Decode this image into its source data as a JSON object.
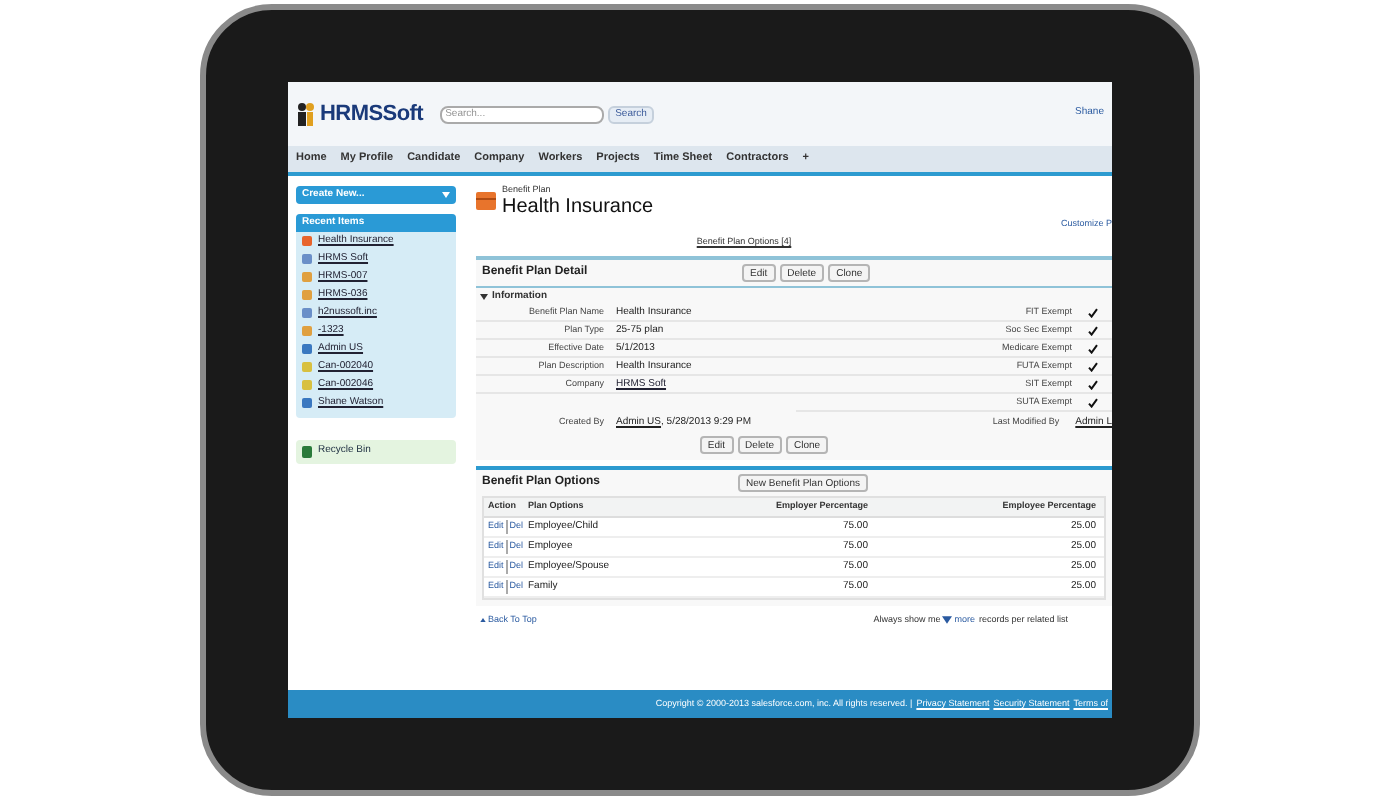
{
  "header": {
    "logo": "HRMSSoft",
    "search": {
      "placeholder": "Search..."
    },
    "search_button": "Search",
    "user": "Shane"
  },
  "nav": [
    {
      "label": "Home",
      "selected": false
    },
    {
      "label": "My Profile",
      "selected": false
    },
    {
      "label": "Candidate",
      "selected": false
    },
    {
      "label": "Company",
      "selected": false
    },
    {
      "label": "Workers",
      "selected": false
    },
    {
      "label": "Projects",
      "selected": false
    },
    {
      "label": "Time Sheet",
      "selected": false
    },
    {
      "label": "Contractors",
      "selected": false
    },
    {
      "label": "+",
      "selected": false
    }
  ],
  "sidebar": {
    "create_new": "Create New...",
    "recent_title": "Recent Items",
    "recent_items": [
      {
        "label": "Health Insurance",
        "kind": "plan"
      },
      {
        "label": "HRMS Soft",
        "kind": "account"
      },
      {
        "label": "HRMS-007",
        "kind": "worker"
      },
      {
        "label": "HRMS-036",
        "kind": "worker"
      },
      {
        "label": "h2nussoft.inc",
        "kind": "account"
      },
      {
        "label": "-1323",
        "kind": "worker"
      },
      {
        "label": "Admin US",
        "kind": "user"
      },
      {
        "label": "Can-002040",
        "kind": "candidate"
      },
      {
        "label": "Can-002046",
        "kind": "candidate"
      },
      {
        "label": "Shane Watson",
        "kind": "user"
      }
    ],
    "recycle_bin": "Recycle Bin"
  },
  "page": {
    "object_type": "Benefit Plan",
    "title": "Health Insurance",
    "customize_link": "Customize P",
    "related_link": "Benefit Plan Options [4]"
  },
  "detail": {
    "title": "Benefit Plan Detail",
    "buttons": [
      "Edit",
      "Delete",
      "Clone"
    ],
    "section": "Information",
    "left_fields": [
      {
        "label": "Benefit Plan Name",
        "value": "Health Insurance",
        "link": false
      },
      {
        "label": "Plan Type",
        "value": "25-75 plan",
        "link": false
      },
      {
        "label": "Effective Date",
        "value": "5/1/2013",
        "link": false
      },
      {
        "label": "Plan Description",
        "value": "Health Insurance",
        "link": false
      },
      {
        "label": "Company",
        "value": "HRMS Soft",
        "link": true
      }
    ],
    "right_fields": [
      {
        "label": "FIT Exempt",
        "checked": true
      },
      {
        "label": "Soc Sec Exempt",
        "checked": true
      },
      {
        "label": "Medicare Exempt",
        "checked": true
      },
      {
        "label": "FUTA Exempt",
        "checked": true
      },
      {
        "label": "SIT Exempt",
        "checked": true
      },
      {
        "label": "SUTA Exempt",
        "checked": true
      }
    ],
    "created_by_label": "Created By",
    "created_by_user": "Admin US",
    "created_by_date": ", 5/28/2013 9:29 PM",
    "modified_by_label": "Last Modified By",
    "modified_by_user": "Admin L",
    "bottom_buttons": [
      "Edit",
      "Delete",
      "Clone"
    ]
  },
  "options": {
    "title": "Benefit Plan Options",
    "new_button": "New Benefit Plan Options",
    "columns": [
      "Action",
      "Plan Options",
      "Employer Percentage",
      "Employee Percentage"
    ],
    "rows": [
      {
        "edit": "Edit",
        "del": "Del",
        "option": "Employee/Child",
        "employer": "75.00",
        "employee": "25.00"
      },
      {
        "edit": "Edit",
        "del": "Del",
        "option": "Employee",
        "employer": "75.00",
        "employee": "25.00"
      },
      {
        "edit": "Edit",
        "del": "Del",
        "option": "Employee/Spouse",
        "employer": "75.00",
        "employee": "25.00"
      },
      {
        "edit": "Edit",
        "del": "Del",
        "option": "Family",
        "employer": "75.00",
        "employee": "25.00"
      }
    ]
  },
  "footer": {
    "back_to_top": "Back To Top",
    "always_show": "Always show me",
    "more": "more",
    "records_text": "records per related list",
    "copyright": "Copyright © 2000-2013 salesforce.com, inc. All rights reserved. |",
    "links": [
      "Privacy Statement",
      "Security Statement",
      "Terms of"
    ]
  }
}
